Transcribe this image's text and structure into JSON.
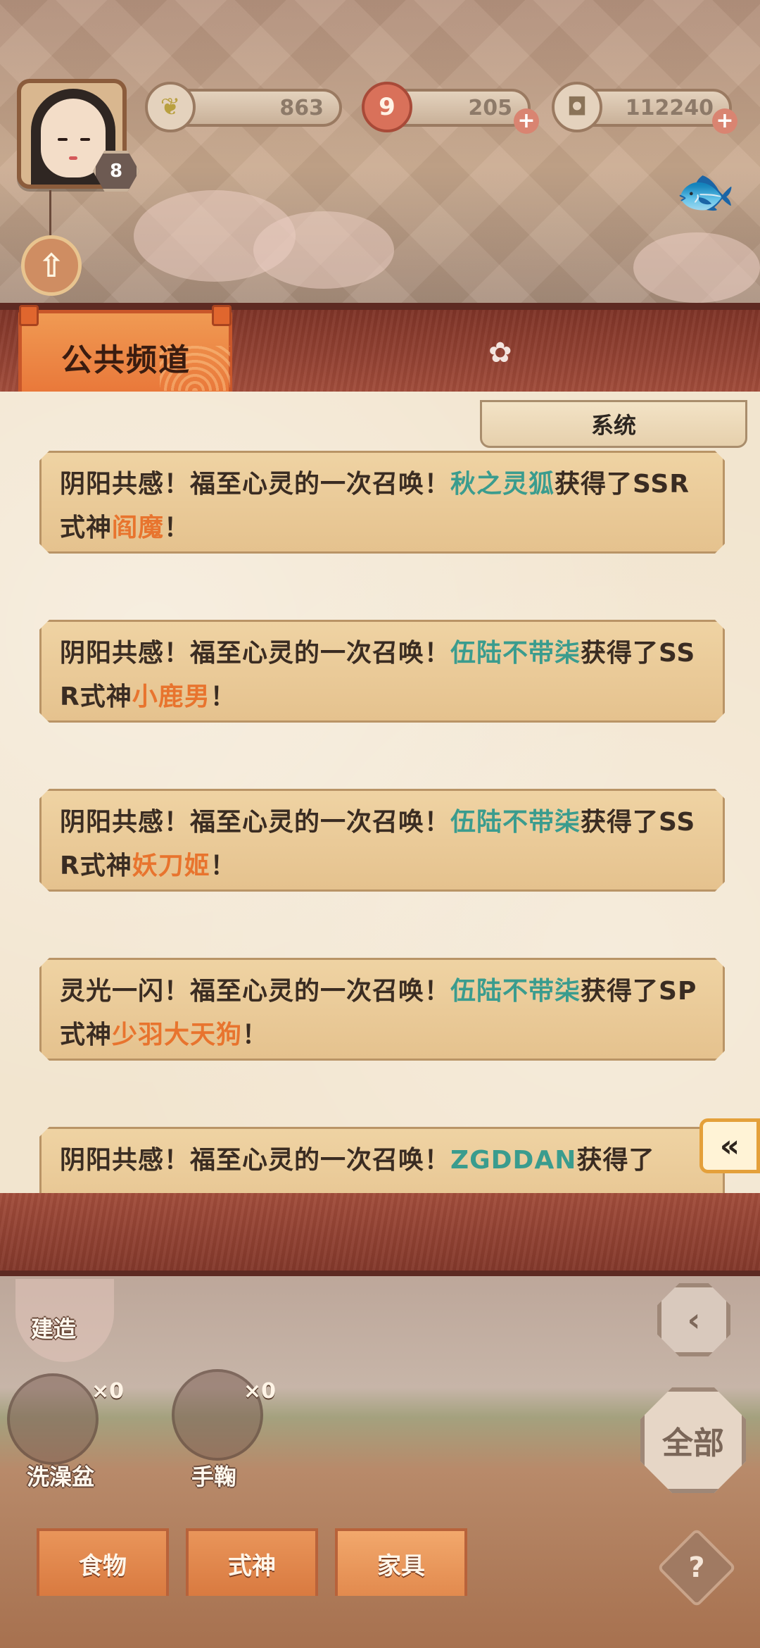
{
  "player": {
    "level": "8"
  },
  "resources": {
    "jade": "863",
    "stamina": "205",
    "coins": "112240"
  },
  "channel": {
    "title": "公共频道",
    "system_tab": "系统"
  },
  "messages": [
    {
      "prefix": "阴阳共感！福至心灵的一次召唤！",
      "player": "秋之灵狐",
      "mid": "获得了SSR式神",
      "shikigami": "阎魔",
      "suffix": "！"
    },
    {
      "prefix": "阴阳共感！福至心灵的一次召唤！",
      "player": "伍陆不带柒",
      "mid": "获得了SSR式神",
      "shikigami": "小鹿男",
      "suffix": "！"
    },
    {
      "prefix": "阴阳共感！福至心灵的一次召唤！",
      "player": "伍陆不带柒",
      "mid": "获得了SSR式神",
      "shikigami": "妖刀姬",
      "suffix": "！"
    },
    {
      "prefix": "灵光一闪！福至心灵的一次召唤！",
      "player": "伍陆不带柒",
      "mid": "获得了SP式神",
      "shikigami": "少羽大天狗",
      "suffix": "！"
    },
    {
      "prefix": "阴阳共感！福至心灵的一次召唤！",
      "player": "ZGDDAN",
      "mid": "获得了",
      "shikigami": "",
      "suffix": ""
    }
  ],
  "bottom": {
    "build_label": "建造",
    "items": [
      {
        "label": "洗澡盆",
        "count": "×0"
      },
      {
        "label": "手鞠",
        "count": "×0"
      }
    ],
    "all_label": "全部",
    "tabs": [
      {
        "label": "食物"
      },
      {
        "label": "式神"
      },
      {
        "label": "家具"
      }
    ],
    "help_label": "?"
  },
  "icons": {
    "collapse": "«",
    "upgrade": "⇧",
    "back": "‹"
  },
  "colors": {
    "player_name": "#3a9c8e",
    "shikigami_name": "#e8742e",
    "accent_tab": "#e9783a",
    "panel_red": "#a24d3b"
  }
}
